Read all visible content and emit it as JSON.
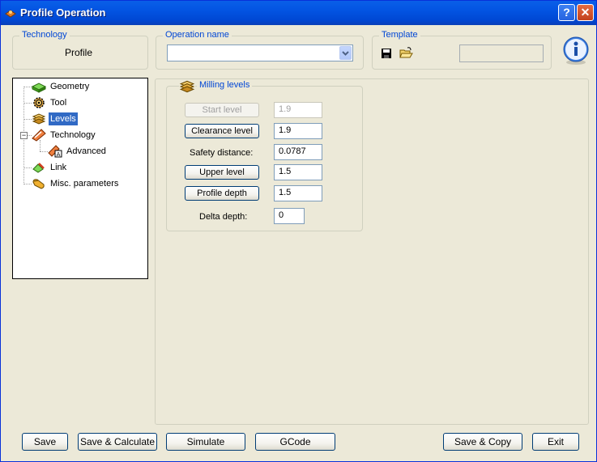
{
  "window": {
    "title": "Profile Operation"
  },
  "title_buttons": {
    "help": "?",
    "close": "✕"
  },
  "technology_group": {
    "title": "Technology",
    "value": "Profile"
  },
  "operation_group": {
    "title": "Operation name",
    "value": ""
  },
  "template_group": {
    "title": "Template",
    "value": ""
  },
  "tree": {
    "items": [
      {
        "label": "Geometry"
      },
      {
        "label": "Tool"
      },
      {
        "label": "Levels"
      },
      {
        "label": "Technology"
      },
      {
        "label": "Advanced"
      },
      {
        "label": "Link"
      },
      {
        "label": "Misc. parameters"
      }
    ],
    "expander": "−"
  },
  "milling": {
    "title": "Milling levels",
    "start_level": {
      "label": "Start level",
      "value": "1.9"
    },
    "clearance_level": {
      "label": "Clearance level",
      "value": "1.9"
    },
    "safety_distance": {
      "label": "Safety distance:",
      "value": "0.0787"
    },
    "upper_level": {
      "label": "Upper level",
      "value": "1.5"
    },
    "profile_depth": {
      "label": "Profile depth",
      "value": "1.5"
    },
    "delta_depth": {
      "label": "Delta depth:",
      "value": "0"
    }
  },
  "bottom": {
    "save": "Save",
    "save_calculate": "Save & Calculate",
    "simulate": "Simulate",
    "gcode": "GCode",
    "save_copy": "Save & Copy",
    "exit": "Exit"
  },
  "colors": {
    "title_bar": "#0354e2",
    "group_title": "#0046d5",
    "selection": "#316ac5",
    "window_bg": "#ece9d8"
  }
}
